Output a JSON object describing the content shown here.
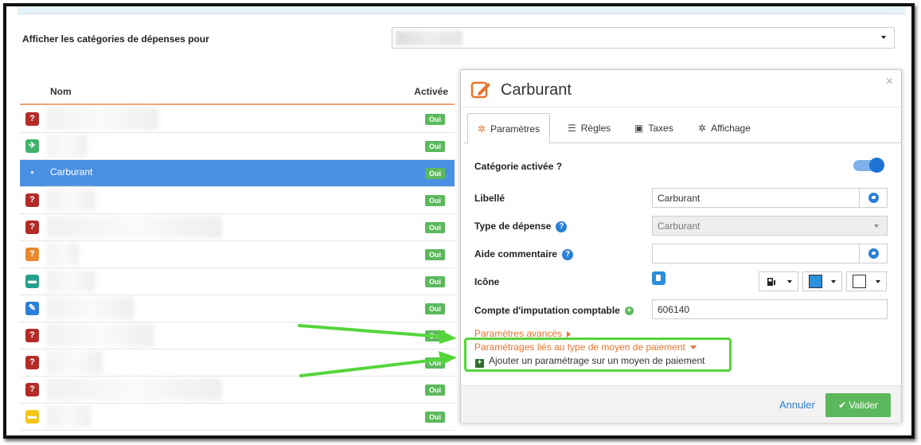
{
  "filter": {
    "label": "Afficher les catégories de dépenses pour"
  },
  "list": {
    "col_name": "Nom",
    "col_active": "Activée",
    "rows": [
      {
        "icon": "question-icon",
        "color": "#b52b27",
        "glyph": "?",
        "name": "",
        "active": "Oui",
        "selected": false
      },
      {
        "icon": "plane-icon",
        "color": "#3fb26b",
        "glyph": "✈",
        "name": "",
        "active": "Oui",
        "selected": false
      },
      {
        "icon": "fuel-icon",
        "color": "#2a8fdc",
        "glyph": "▪",
        "name": "Carburant",
        "active": "Oui",
        "selected": true
      },
      {
        "icon": "question-icon",
        "color": "#b52b27",
        "glyph": "?",
        "name": "",
        "active": "Oui",
        "selected": false
      },
      {
        "icon": "question-icon",
        "color": "#b52b27",
        "glyph": "?",
        "name": "",
        "active": "Oui",
        "selected": false
      },
      {
        "icon": "question-icon",
        "color": "#e8892e",
        "glyph": "?",
        "name": "",
        "active": "Oui",
        "selected": false
      },
      {
        "icon": "car-icon",
        "color": "#25a18e",
        "glyph": "▬",
        "name": "",
        "active": "Oui",
        "selected": false
      },
      {
        "icon": "wrench-icon",
        "color": "#2a7fd6",
        "glyph": "✎",
        "name": "",
        "active": "Oui",
        "selected": false
      },
      {
        "icon": "question-icon",
        "color": "#b52b27",
        "glyph": "?",
        "name": "",
        "active": "Oui",
        "selected": false
      },
      {
        "icon": "question-icon",
        "color": "#b52b27",
        "glyph": "?",
        "name": "",
        "active": "Oui",
        "selected": false
      },
      {
        "icon": "question-icon",
        "color": "#b52b27",
        "glyph": "?",
        "name": "",
        "active": "Oui",
        "selected": false
      },
      {
        "icon": "bed-icon",
        "color": "#f5c518",
        "glyph": "▬",
        "name": "",
        "active": "Oui",
        "selected": false
      }
    ]
  },
  "modal": {
    "title": "Carburant",
    "close": "×",
    "tabs": [
      {
        "label": "Paramètres",
        "icon": "gear-icon",
        "glyph": "✲"
      },
      {
        "label": "Règles",
        "icon": "sliders-icon",
        "glyph": "☰"
      },
      {
        "label": "Taxes",
        "icon": "money-icon",
        "glyph": "▣"
      },
      {
        "label": "Affichage",
        "icon": "gears-icon",
        "glyph": "✲"
      }
    ],
    "fields": {
      "enabled_label": "Catégorie activée ?",
      "libelle_label": "Libellé",
      "libelle_value": "Carburant",
      "type_label": "Type de dépense",
      "type_value": "Carburant",
      "aide_label": "Aide commentaire",
      "aide_value": "",
      "icone_label": "Icône",
      "compte_label": "Compte d'imputation comptable",
      "compte_value": "606140"
    },
    "advanced": "Paramètres avancés",
    "payment_title": "Paramétrages liés au type de moyen de paiement",
    "payment_add": "Ajouter un paramétrage sur un moyen de paiement",
    "cancel": "Annuler",
    "save": "Valider"
  },
  "colors": {
    "accent": "#e8732e",
    "primary": "#2a7fd6",
    "success": "#5cb85c",
    "highlight": "#55d53b",
    "icon_color_swatch": "#2a8fdc",
    "icon_bg_swatch": "#ffffff"
  }
}
